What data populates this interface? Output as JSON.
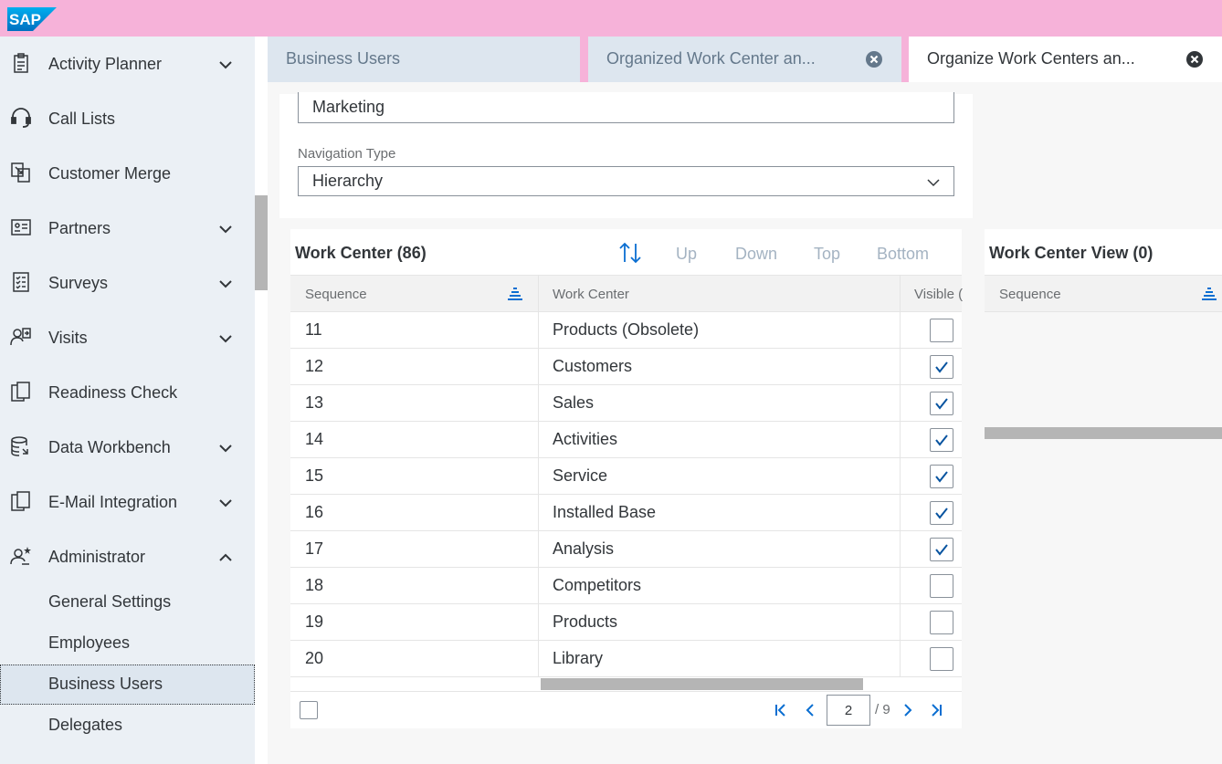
{
  "shell": {
    "logo_text": "SAP"
  },
  "sidebar": {
    "items": [
      {
        "label": "Activity Planner",
        "icon": "clipboard-icon",
        "expandable": true
      },
      {
        "label": "Call Lists",
        "icon": "headset-icon",
        "expandable": false
      },
      {
        "label": "Customer Merge",
        "icon": "merge-icon",
        "expandable": false
      },
      {
        "label": "Partners",
        "icon": "partner-card-icon",
        "expandable": true
      },
      {
        "label": "Surveys",
        "icon": "survey-icon",
        "expandable": true
      },
      {
        "label": "Visits",
        "icon": "visit-icon",
        "expandable": true
      },
      {
        "label": "Readiness Check",
        "icon": "copy-icon",
        "expandable": false
      },
      {
        "label": "Data Workbench",
        "icon": "database-icon",
        "expandable": true
      },
      {
        "label": "E-Mail Integration",
        "icon": "copy-icon",
        "expandable": true
      },
      {
        "label": "Administrator",
        "icon": "admin-user-icon",
        "expandable": true,
        "expanded": true
      }
    ],
    "subitems": [
      {
        "label": "General Settings"
      },
      {
        "label": "Employees"
      },
      {
        "label": "Business Users",
        "active": true
      },
      {
        "label": "Delegates"
      }
    ]
  },
  "tabs": [
    {
      "label": "Business Users",
      "closable": false
    },
    {
      "label": "Organized Work Center an...",
      "closable": true
    },
    {
      "label": "Organize Work Centers an...",
      "closable": true,
      "active": true
    }
  ],
  "form": {
    "name_value": "Marketing",
    "navigation_type_label": "Navigation Type",
    "navigation_type_value": "Hierarchy"
  },
  "work_center_table": {
    "title": "Work Center  (86)",
    "toolbar": {
      "up": "Up",
      "down": "Down",
      "top": "Top",
      "bottom": "Bottom"
    },
    "columns": [
      "Sequence",
      "Work Center",
      "Visible ("
    ],
    "rows": [
      {
        "sequence": "11",
        "work_center": "Products (Obsolete)",
        "visible": false
      },
      {
        "sequence": "12",
        "work_center": "Customers",
        "visible": true
      },
      {
        "sequence": "13",
        "work_center": "Sales",
        "visible": true
      },
      {
        "sequence": "14",
        "work_center": "Activities",
        "visible": true
      },
      {
        "sequence": "15",
        "work_center": "Service",
        "visible": true
      },
      {
        "sequence": "16",
        "work_center": "Installed Base",
        "visible": true
      },
      {
        "sequence": "17",
        "work_center": "Analysis",
        "visible": true
      },
      {
        "sequence": "18",
        "work_center": "Competitors",
        "visible": false
      },
      {
        "sequence": "19",
        "work_center": "Products",
        "visible": false
      },
      {
        "sequence": "20",
        "work_center": "Library",
        "visible": false
      }
    ],
    "pagination": {
      "current_page": "2",
      "total_pages": "/ 9"
    }
  },
  "work_center_view_table": {
    "title": "Work Center View  (0)",
    "columns": [
      "Sequence"
    ]
  },
  "colors": {
    "shell": "#f6b2d9",
    "sidebar": "#ebf0f5",
    "accent": "#0a6ed1",
    "checkbox_check": "#0854a0"
  }
}
